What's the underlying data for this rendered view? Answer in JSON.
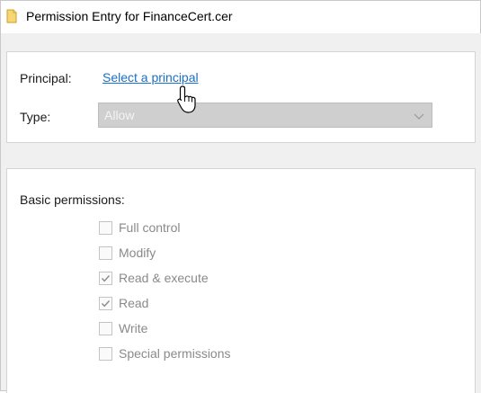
{
  "window": {
    "title": "Permission Entry for FinanceCert.cer",
    "icon": "file-icon"
  },
  "principal": {
    "label": "Principal:",
    "link_text": "Select a principal"
  },
  "type": {
    "label": "Type:",
    "selected_value": "Allow",
    "disabled": true
  },
  "permissions": {
    "heading": "Basic permissions:",
    "items": [
      {
        "label": "Full control",
        "checked": false
      },
      {
        "label": "Modify",
        "checked": false
      },
      {
        "label": "Read & execute",
        "checked": true
      },
      {
        "label": "Read",
        "checked": true
      },
      {
        "label": "Write",
        "checked": false
      },
      {
        "label": "Special permissions",
        "checked": false
      }
    ]
  },
  "colors": {
    "link": "#1a6fc8",
    "disabled_text": "#8a8a8a",
    "select_bg": "#cfcfcf"
  }
}
